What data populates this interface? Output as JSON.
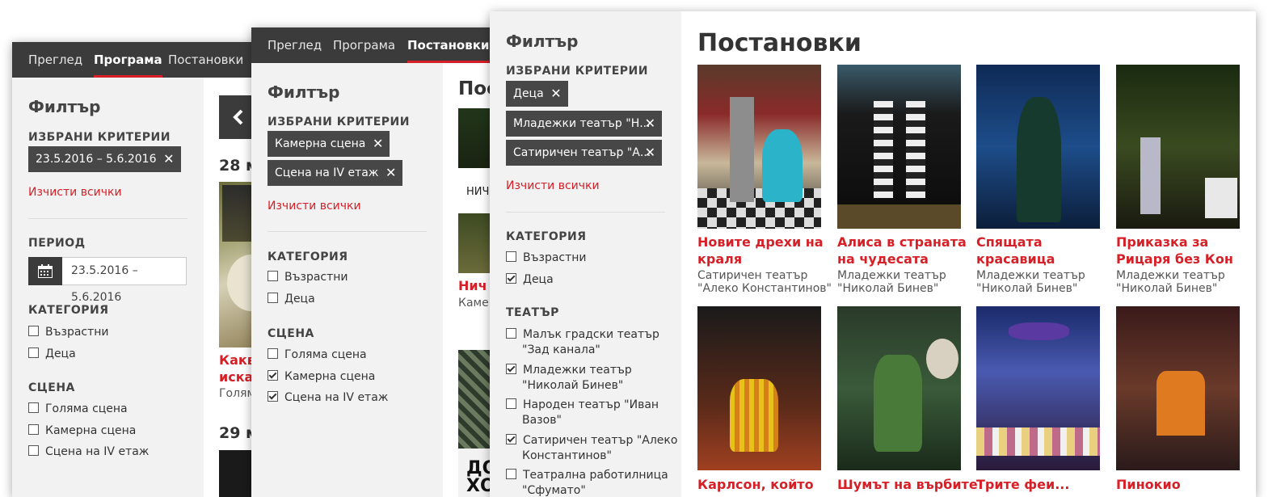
{
  "colors": {
    "accent": "#d61f26",
    "nav_bg": "#3b3b3b",
    "chip_bg": "#474747",
    "sidebar_bg": "#f2f2f2"
  },
  "win1": {
    "nav": [
      "Преглед",
      "Програма",
      "Постановки"
    ],
    "active_nav": "Програма",
    "filter_title": "Филтър",
    "selected_heading": "ИЗБРАНИ КРИТЕРИИ",
    "chips": [
      "23.5.2016 – 5.6.2016"
    ],
    "clear_all": "Изчисти всички",
    "period_heading": "ПЕРИОД",
    "period_value": "23.5.2016 – 5.6.2016",
    "category_heading": "КАТЕГОРИЯ",
    "categories": [
      "Възрастни",
      "Деца"
    ],
    "stage_heading": "СЦЕНА",
    "stages": [
      "Голяма сцена",
      "Камерна сцена",
      "Сцена на IV етаж"
    ],
    "date1": "28 м",
    "date2": "29 м",
    "event_title_l1": "Каква",
    "event_title_l2": "искал",
    "event_sub": "Голям"
  },
  "win2": {
    "nav": [
      "Преглед",
      "Програма",
      "Постановки"
    ],
    "active_nav": "Постановки",
    "filter_title": "Филтър",
    "selected_heading": "ИЗБРАНИ КРИТЕРИИ",
    "chips": [
      "Камерна сцена",
      "Сцена на IV етаж"
    ],
    "clear_all": "Изчисти всички",
    "category_heading": "КАТЕГОРИЯ",
    "categories": [
      "Възрастни",
      "Деца"
    ],
    "stage_heading": "СЦЕНА",
    "stages": [
      "Голяма сцена",
      "Камерна сцена",
      "Сцена на IV етаж"
    ],
    "stages_checked": [
      false,
      true,
      true
    ],
    "page_title_part": "Пос",
    "caption1": "НИЧ",
    "item_title": "Нич",
    "item_sub": "Камер",
    "poster_text_l1": "ДО",
    "poster_text_l2": "ХО"
  },
  "win3": {
    "filter_title": "Филтър",
    "selected_heading": "ИЗБРАНИ КРИТЕРИИ",
    "chips": [
      "Деца",
      "Младежки театър \"Н...",
      "Сатиричен театър \"А..."
    ],
    "clear_all": "Изчисти всички",
    "category_heading": "КАТЕГОРИЯ",
    "categories": [
      "Възрастни",
      "Деца"
    ],
    "categories_checked": [
      false,
      true
    ],
    "theatre_heading": "ТЕАТЪР",
    "theatres": [
      {
        "l1": "Малък градски театър",
        "l2": "\"Зад канала\"",
        "checked": false
      },
      {
        "l1": "Младежки театър",
        "l2": "\"Николай Бинев\"",
        "checked": true
      },
      {
        "l1": "Народен театър \"Иван",
        "l2": "Вазов\"",
        "checked": false
      },
      {
        "l1": "Сатиричен театър \"Алеко",
        "l2": "Константинов\"",
        "checked": true
      },
      {
        "l1": "Театрална работилница",
        "l2": "\"Сфумато\"",
        "checked": false
      }
    ],
    "page_title": "Постановки",
    "shows": [
      {
        "t1": "Новите дрехи на",
        "t2": "краля",
        "s1": "Сатиричен театър",
        "s2": "\"Алеко Константинов\""
      },
      {
        "t1": "Алиса в страната",
        "t2": "на чудесата",
        "s1": "Младежки театър",
        "s2": "\"Николай Бинев\""
      },
      {
        "t1": "Спящата",
        "t2": "красавица",
        "s1": "Младежки театър",
        "s2": "\"Николай Бинев\""
      },
      {
        "t1": "Приказка за",
        "t2": "Рицаря без Кон",
        "s1": "Младежки театър",
        "s2": "\"Николай Бинев\""
      },
      {
        "t1": "Карлсон, който",
        "t2": "",
        "s1": "",
        "s2": ""
      },
      {
        "t1": "Шумът на върбите",
        "t2": "",
        "s1": "",
        "s2": ""
      },
      {
        "t1": "Трите феи...",
        "t2": "",
        "s1": "",
        "s2": ""
      },
      {
        "t1": "Пинокио",
        "t2": "",
        "s1": "",
        "s2": ""
      }
    ]
  }
}
